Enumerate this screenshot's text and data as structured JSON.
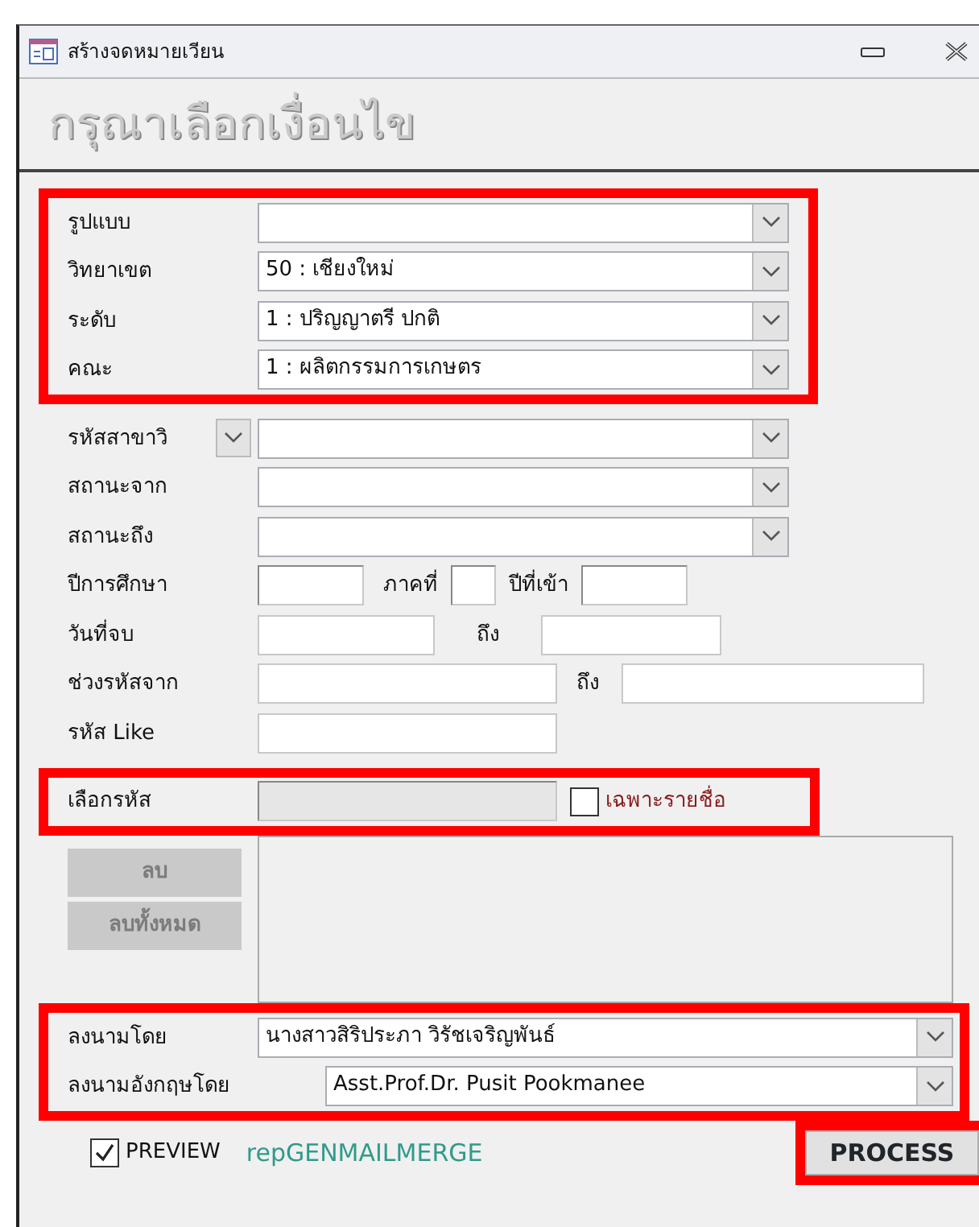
{
  "window": {
    "title": "สร้างจดหมายเวียน"
  },
  "heading": "กรุณาเลือกเงื่อนไข",
  "sections": [
    {
      "highlighted": true,
      "rows": [
        {
          "kind": "combo",
          "label": "รูปแบบ"
        },
        {
          "kind": "combo",
          "label": "วิทยาเขต",
          "value": "50 : เชียงใหม่"
        },
        {
          "kind": "combo",
          "label": "ระดับ",
          "value": "1 : ปริญญาตรี  ปกติ"
        },
        {
          "kind": "combo",
          "label": "คณะ",
          "value": "1 : ผลิตกรรมการเกษตร"
        }
      ]
    },
    {
      "highlighted": false,
      "rows": [
        {
          "kind": "combo-picker",
          "label": "รหัสสาขาวิ"
        },
        {
          "kind": "combo",
          "label": "สถานะจาก"
        },
        {
          "kind": "combo",
          "label": "สถานะถึง"
        },
        {
          "kind": "year",
          "label": "ปีการศึกษา",
          "label_2": "ภาคที่",
          "label_3": "ปีที่เข้า"
        },
        {
          "kind": "range",
          "label": "วันที่จบ",
          "label_2": "ถึง"
        },
        {
          "kind": "range-wide",
          "label": "ช่วงรหัสจาก",
          "label_2": "ถึง"
        },
        {
          "kind": "text",
          "label": "รหัส Like"
        }
      ]
    },
    {
      "highlighted": true,
      "rows": [
        {
          "kind": "pick",
          "label": "เลือกรหัส",
          "checkbox_label": "เฉพาะรายชื่อ",
          "checked": false
        }
      ]
    }
  ],
  "list_buttons": [
    {
      "label": "ลบ",
      "disabled": true
    },
    {
      "label": "ลบทั้งหมด",
      "disabled": true
    }
  ],
  "signers": {
    "highlighted": true,
    "rows": [
      {
        "label": "ลงนามโดย",
        "value": "นางสาวสิริประภา  วิรัชเจริญพันธ์"
      },
      {
        "label": "ลงนามอังกฤษโดย",
        "value": "Asst.Prof.Dr. Pusit Pookmanee"
      }
    ]
  },
  "footer": {
    "preview": {
      "label": "PREVIEW",
      "checked": true
    },
    "report": "repGENMAILMERGE",
    "process": {
      "label": "PROCESS",
      "highlighted": true
    }
  }
}
